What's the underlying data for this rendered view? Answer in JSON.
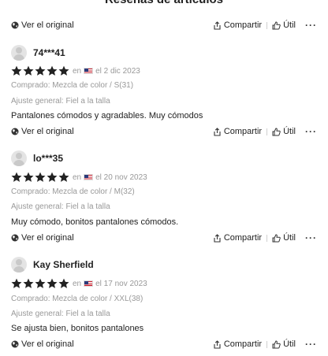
{
  "title": "Reseñas de artículos",
  "actions": {
    "see_original": "Ver el original",
    "share": "Compartir",
    "useful": "Útil",
    "more": "···"
  },
  "icons": [
    "globe-icon",
    "share-icon",
    "thumbs-up-icon",
    "more-icon",
    "star-icon",
    "us-flag-icon",
    "avatar-icon"
  ],
  "colors": {
    "star": "#222222",
    "meta_text": "#999999"
  },
  "reviews": [
    {
      "user": "74***41",
      "rating": 5,
      "prefix": "en",
      "date": "el 2 dic 2023",
      "purchased": "Comprado: Mezcla de color / S(31)",
      "fit": "Ajuste general: Fiel a la talla",
      "comment": "Pantalones cómodos y agradables. Muy cómodos"
    },
    {
      "user": "lo***35",
      "rating": 5,
      "prefix": "en",
      "date": "el 20 nov 2023",
      "purchased": "Comprado: Mezcla de color / M(32)",
      "fit": "Ajuste general: Fiel a la talla",
      "comment": "Muy cómodo, bonitos pantalones cómodos."
    },
    {
      "user": "Kay Sherfield",
      "rating": 5,
      "prefix": "en",
      "date": "el 17 nov 2023",
      "purchased": "Comprado: Mezcla de color / XXL(38)",
      "fit": "Ajuste general: Fiel a la talla",
      "comment": "Se ajusta bien, bonitos pantalones"
    }
  ]
}
